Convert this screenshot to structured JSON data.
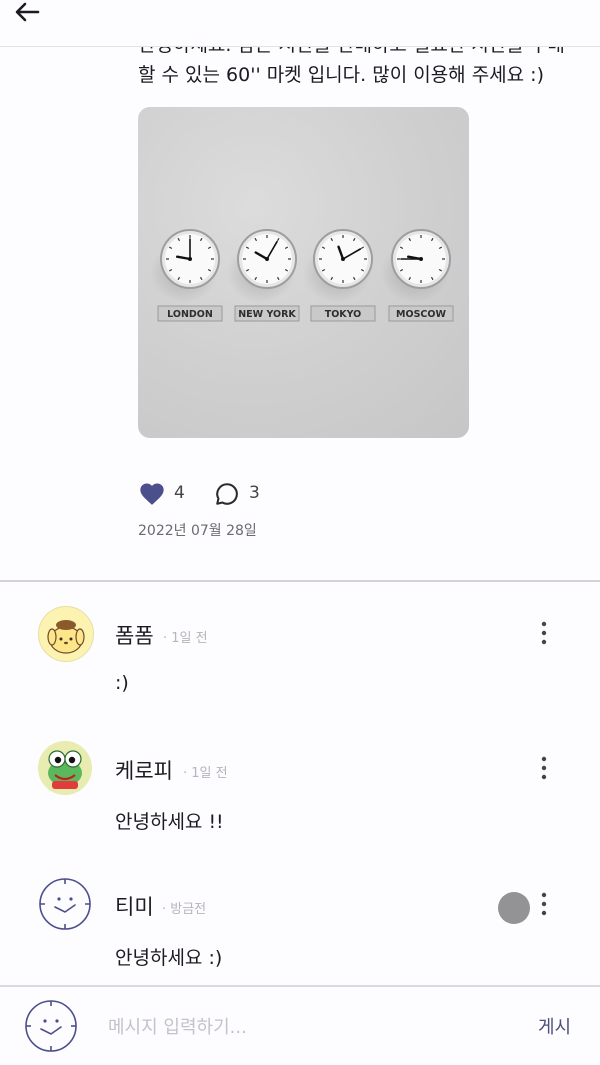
{
  "header": {
    "back_icon": "arrow-left-icon"
  },
  "post": {
    "text_line1": "안녕하세요. 남는 시간을 판매하고 필요한 시간을 구매",
    "text_line2": "할 수 있는 60'' 마켓 입니다. 많이 이용해 주세요 :)",
    "image": {
      "clock_labels": [
        "LONDON",
        "NEW YORK",
        "TOKYO",
        "MOSCOW"
      ]
    },
    "likes": "4",
    "comments_count": "3",
    "date": "2022년 07월 28일",
    "colors": {
      "heart": "#4b4f8c"
    }
  },
  "comments": [
    {
      "name": "폼폼",
      "time": "· 1일 전",
      "text": ":)",
      "avatar": "pompompurin-avatar"
    },
    {
      "name": "케로피",
      "time": "· 1일 전",
      "text": "안녕하세요 !!",
      "avatar": "keroppi-avatar"
    },
    {
      "name": "티미",
      "time": "· 방금전",
      "text": "안녕하세요 :)",
      "avatar": "smiley-clock-avatar"
    }
  ],
  "composer": {
    "placeholder": "메시지 입력하기...",
    "post_label": "게시"
  }
}
